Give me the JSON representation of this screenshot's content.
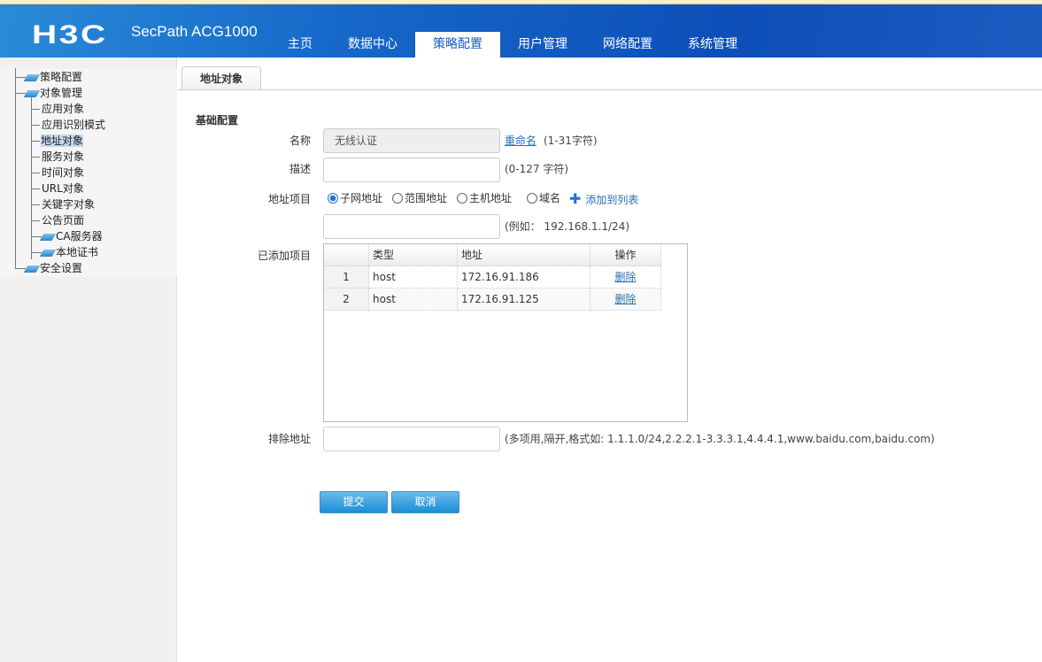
{
  "header": {
    "logo": "H3C",
    "product": "SecPath ACG1000",
    "nav": [
      "主页",
      "数据中心",
      "策略配置",
      "用户管理",
      "网络配置",
      "系统管理"
    ],
    "active_nav": "策略配置"
  },
  "sidebar": {
    "items": [
      {
        "label": "策略配置"
      },
      {
        "label": "对象管理"
      },
      {
        "label": "应用对象"
      },
      {
        "label": "应用识别模式"
      },
      {
        "label": "地址对象",
        "selected": true
      },
      {
        "label": "服务对象"
      },
      {
        "label": "时间对象"
      },
      {
        "label": "URL对象"
      },
      {
        "label": "关键字对象"
      },
      {
        "label": "公告页面"
      },
      {
        "label": "CA服务器"
      },
      {
        "label": "本地证书"
      },
      {
        "label": "安全设置"
      }
    ]
  },
  "main": {
    "tab": "地址对象",
    "section": "基础配置",
    "name_label": "名称",
    "name_value": "无线认证",
    "rename_link": "重命名",
    "name_hint": "(1-31字符)",
    "desc_label": "描述",
    "desc_hint": "(0-127 字符)",
    "addr_label": "地址项目",
    "radios": [
      "子网地址",
      "范围地址",
      "主机地址",
      "域名"
    ],
    "radio_selected": "子网地址",
    "add_to_list": "添加到列表",
    "addr_hint": "(例如： 192.168.1.1/24)",
    "added_label": "已添加项目",
    "table": {
      "headers": [
        "",
        "类型",
        "地址",
        "操作"
      ],
      "rows": [
        {
          "index": "1",
          "type": "host",
          "address": "172.16.91.186",
          "action": "删除"
        },
        {
          "index": "2",
          "type": "host",
          "address": "172.16.91.125",
          "action": "删除"
        }
      ]
    },
    "exclude_label": "排除地址",
    "exclude_hint": "(多项用,隔开,格式如: 1.1.1.0/24,2.2.2.1-3.3.3.1,4.4.4.1,www.baidu.com,baidu.com)",
    "submit": "提交",
    "cancel": "取消"
  }
}
